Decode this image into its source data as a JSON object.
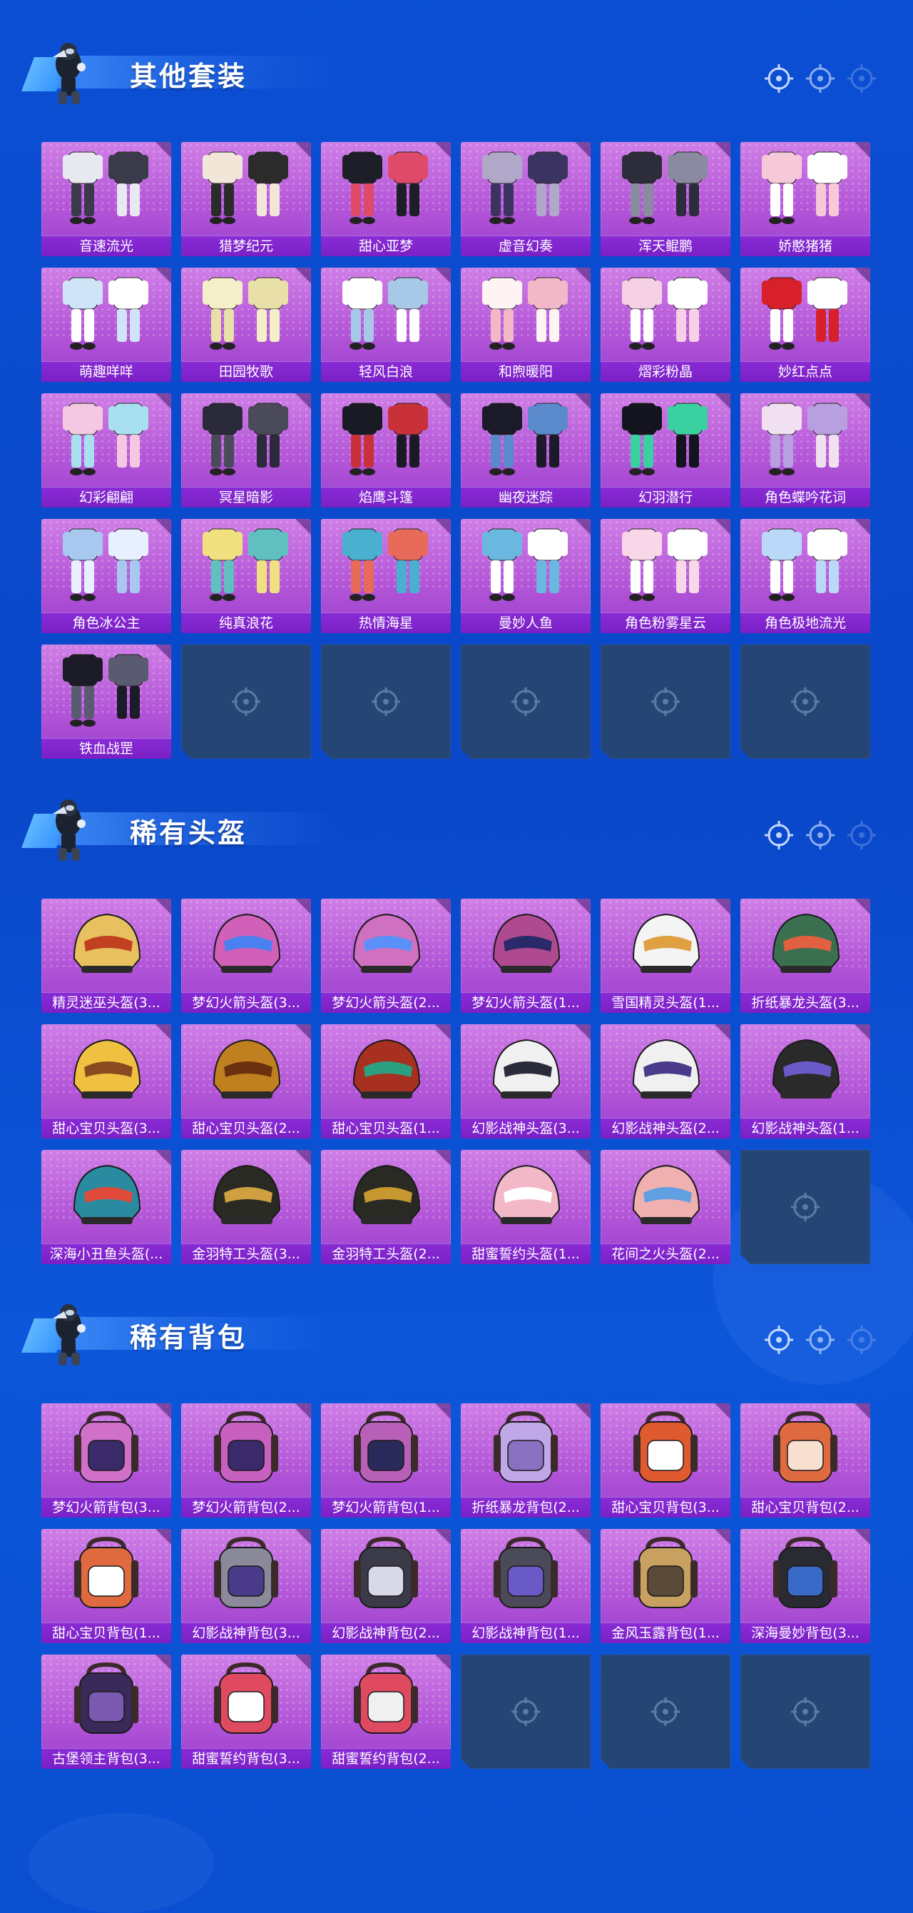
{
  "sections": [
    {
      "title": "其他套装",
      "kind": "outfit",
      "items": [
        "音速流光",
        "猎梦纪元",
        "甜心亚梦",
        "虚音幻奏",
        "浑天鲲鹏",
        "娇憨猪猪",
        "萌趣咩咩",
        "田园牧歌",
        "轻风白浪",
        "和煦暖阳",
        "熠彩粉晶",
        "妙红点点",
        "幻彩翩翩",
        "冥星暗影",
        "焰鹰斗篷",
        "幽夜迷踪",
        "幻羽潜行",
        "角色蝶吟花词",
        "角色冰公主",
        "纯真浪花",
        "热情海星",
        "曼妙人鱼",
        "角色粉雾星云",
        "角色极地流光",
        "铁血战罡"
      ],
      "empty_slots": 5
    },
    {
      "title": "稀有头盔",
      "kind": "helmet",
      "items": [
        "精灵迷巫头盔(3...",
        "梦幻火箭头盔(3...",
        "梦幻火箭头盔(2...",
        "梦幻火箭头盔(1...",
        "雪国精灵头盔(1...",
        "折纸暴龙头盔(3...",
        "甜心宝贝头盔(3...",
        "甜心宝贝头盔(2...",
        "甜心宝贝头盔(1...",
        "幻影战神头盔(3...",
        "幻影战神头盔(2...",
        "幻影战神头盔(1...",
        "深海小丑鱼头盔(...",
        "金羽特工头盔(3...",
        "金羽特工头盔(2...",
        "甜蜜誓约头盔(1...",
        "花间之火头盔(2..."
      ],
      "empty_slots": 1
    },
    {
      "title": "稀有背包",
      "kind": "backpack",
      "items": [
        "梦幻火箭背包(3...",
        "梦幻火箭背包(2...",
        "梦幻火箭背包(1...",
        "折纸暴龙背包(2...",
        "甜心宝贝背包(3...",
        "甜心宝贝背包(2...",
        "甜心宝贝背包(1...",
        "幻影战神背包(3...",
        "幻影战神背包(2...",
        "幻影战神背包(1...",
        "金风玉露背包(1...",
        "深海曼妙背包(3...",
        "古堡领主背包(3...",
        "甜蜜誓约背包(3...",
        "甜蜜誓约背包(2..."
      ],
      "empty_slots": 3
    }
  ],
  "colors": {
    "card_top": "#cf7ee6",
    "card_label": "#7a20c6",
    "empty_slot": "#254575",
    "background": "#0b4fd4"
  }
}
